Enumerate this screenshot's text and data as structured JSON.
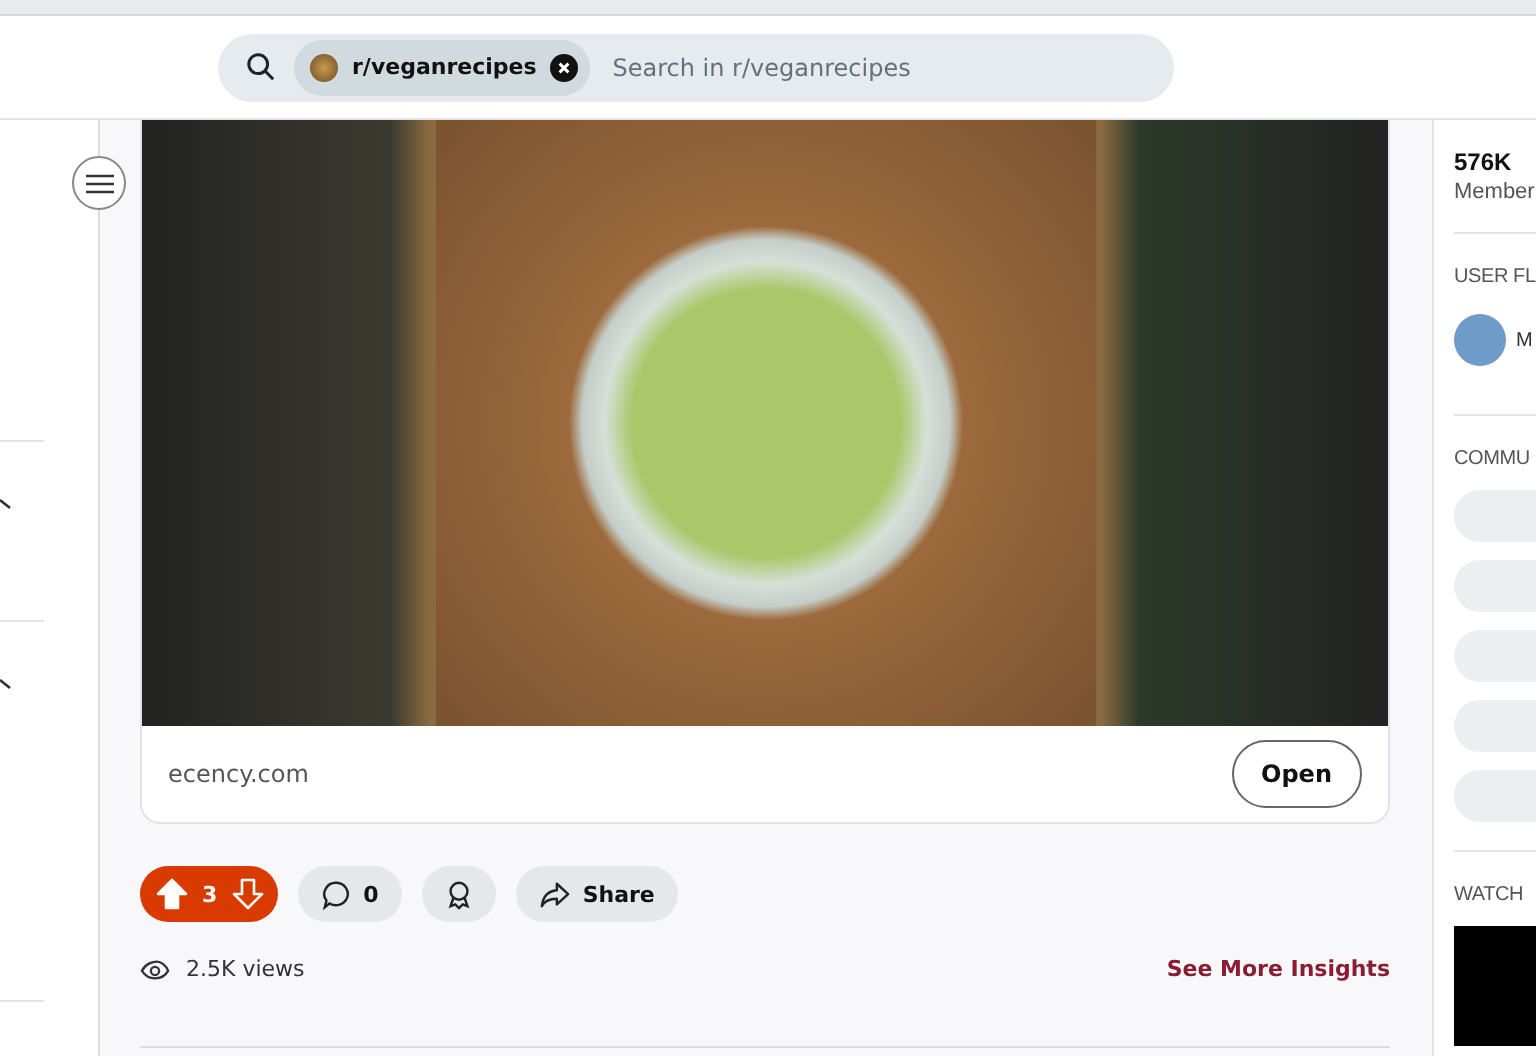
{
  "search": {
    "scope": "r/veganrecipes",
    "placeholder": "Search in r/veganrecipes"
  },
  "post": {
    "link_domain": "ecency.com",
    "open_button": "Open",
    "votes": {
      "count": "3",
      "upvoted": true
    },
    "comments": "0",
    "share": "Share",
    "views": "2.5K views",
    "insights": "See More Insights"
  },
  "right_sidebar": {
    "members_count": "576K",
    "members_label": "Member",
    "flair_heading": "USER FL",
    "flair_name": "M",
    "community_heading": "COMMU",
    "watch_heading": "WATCH"
  }
}
